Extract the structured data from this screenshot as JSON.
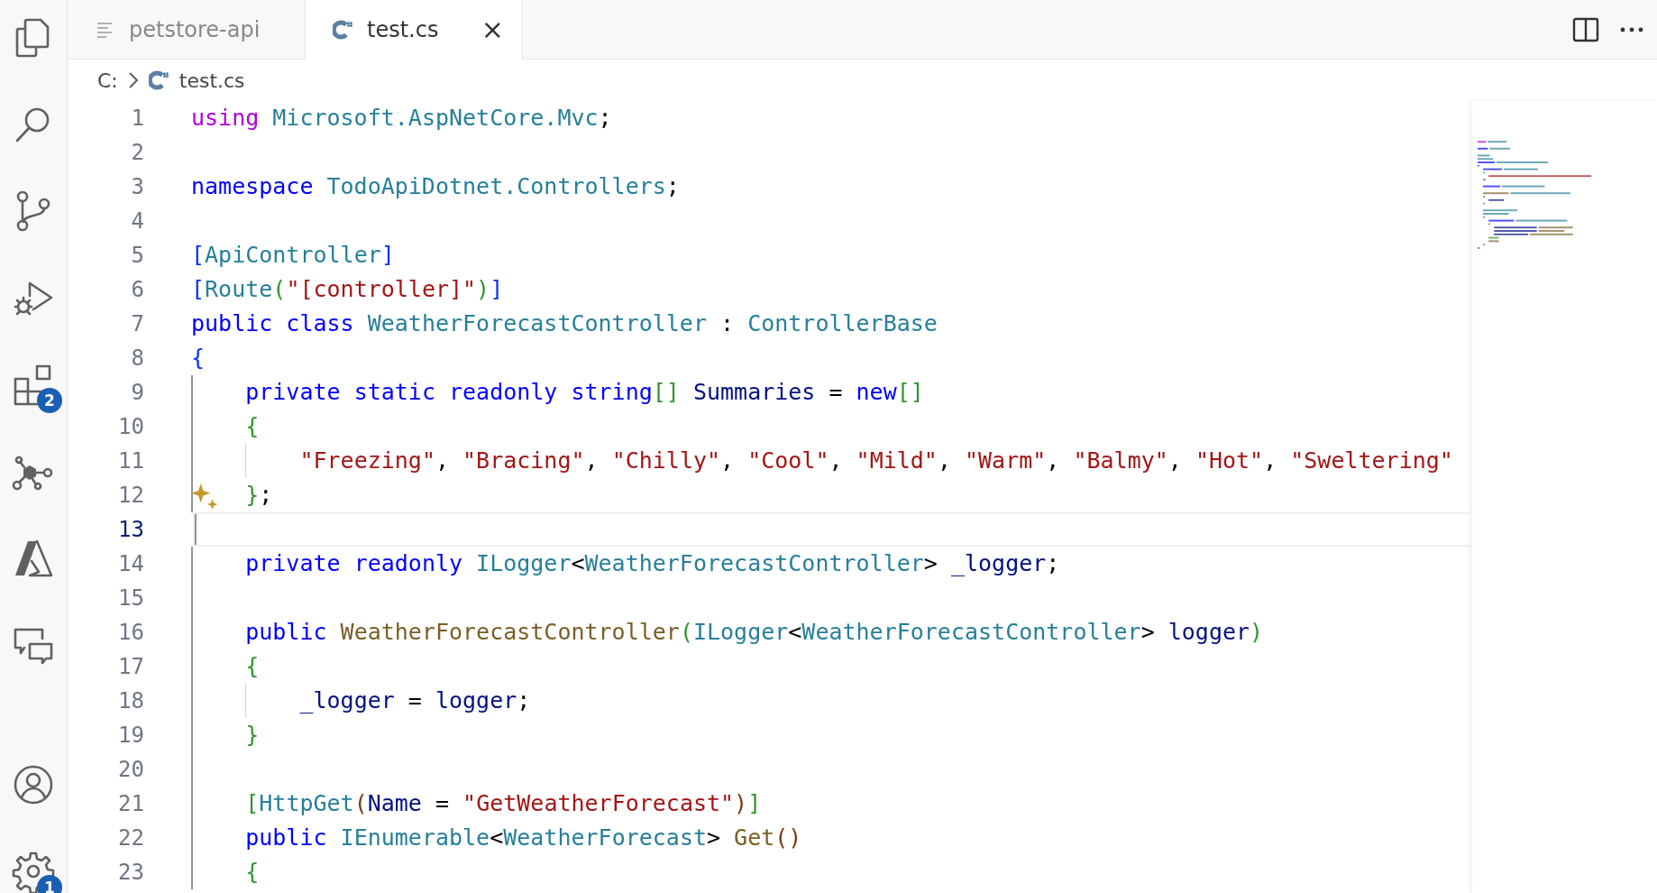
{
  "activity_bar": {
    "extensions_badge": "2",
    "settings_badge": "1"
  },
  "tabs": [
    {
      "label": "petstore-api",
      "kind": "preview",
      "selected": false
    },
    {
      "label": "test.cs",
      "kind": "csharp",
      "selected": true,
      "close": "×"
    }
  ],
  "breadcrumb": {
    "items": [
      {
        "label": "C:",
        "kind": "drive"
      },
      {
        "label": "test.cs",
        "kind": "csharp"
      }
    ]
  },
  "editor": {
    "lines": [
      {
        "number": "1",
        "current": false,
        "sparkle": false,
        "tokens": [
          {
            "kind": "ctl",
            "text": "using "
          },
          {
            "kind": "type",
            "text": "Microsoft.AspNetCore.Mvc"
          },
          {
            "kind": "p",
            "text": ";"
          }
        ]
      },
      {
        "number": "2",
        "current": false,
        "sparkle": false
      },
      {
        "number": "3",
        "current": false,
        "sparkle": false,
        "tokens": [
          {
            "kind": "kw",
            "text": "namespace "
          },
          {
            "kind": "type",
            "text": "TodoApiDotnet.Controllers"
          },
          {
            "kind": "p",
            "text": ";"
          }
        ]
      },
      {
        "number": "4",
        "current": false,
        "sparkle": false
      },
      {
        "number": "5",
        "current": false,
        "sparkle": false,
        "tokens": [
          {
            "kind": "b1",
            "text": "["
          },
          {
            "kind": "type",
            "text": "ApiController"
          },
          {
            "kind": "b1",
            "text": "]"
          }
        ]
      },
      {
        "number": "6",
        "current": false,
        "sparkle": false,
        "tokens": [
          {
            "kind": "b1",
            "text": "["
          },
          {
            "kind": "type",
            "text": "Route"
          },
          {
            "kind": "b2",
            "text": "("
          },
          {
            "kind": "str",
            "text": "\"[controller]\""
          },
          {
            "kind": "b2",
            "text": ")"
          },
          {
            "kind": "b1",
            "text": "]"
          }
        ]
      },
      {
        "number": "7",
        "current": false,
        "sparkle": false,
        "tokens": [
          {
            "kind": "kw",
            "text": "public class "
          },
          {
            "kind": "type",
            "text": "WeatherForecastController"
          },
          {
            "kind": "p",
            "text": " : "
          },
          {
            "kind": "type",
            "text": "ControllerBase"
          }
        ]
      },
      {
        "number": "8",
        "current": false,
        "sparkle": false,
        "tokens": [
          {
            "kind": "b1",
            "text": "{"
          }
        ]
      },
      {
        "number": "9",
        "current": false,
        "sparkle": false,
        "tokens": [
          {
            "kind": "kw",
            "text": "    private static readonly string"
          },
          {
            "kind": "b2",
            "text": "[]"
          },
          {
            "kind": "var",
            "text": " Summaries"
          },
          {
            "kind": "p",
            "text": " = "
          },
          {
            "kind": "kw",
            "text": "new"
          },
          {
            "kind": "b2",
            "text": "[]"
          }
        ]
      },
      {
        "number": "10",
        "current": false,
        "sparkle": false,
        "tokens": [
          {
            "kind": "b2",
            "text": "    {"
          }
        ]
      },
      {
        "number": "11",
        "current": false,
        "sparkle": false,
        "tokens": [
          {
            "kind": "str",
            "text": "        \"Freezing\""
          },
          {
            "kind": "p",
            "text": ", "
          },
          {
            "kind": "str",
            "text": "\"Bracing\""
          },
          {
            "kind": "p",
            "text": ", "
          },
          {
            "kind": "str",
            "text": "\"Chilly\""
          },
          {
            "kind": "p",
            "text": ", "
          },
          {
            "kind": "str",
            "text": "\"Cool\""
          },
          {
            "kind": "p",
            "text": ", "
          },
          {
            "kind": "str",
            "text": "\"Mild\""
          },
          {
            "kind": "p",
            "text": ", "
          },
          {
            "kind": "str",
            "text": "\"Warm\""
          },
          {
            "kind": "p",
            "text": ", "
          },
          {
            "kind": "str",
            "text": "\"Balmy\""
          },
          {
            "kind": "p",
            "text": ", "
          },
          {
            "kind": "str",
            "text": "\"Hot\""
          },
          {
            "kind": "p",
            "text": ", "
          },
          {
            "kind": "str",
            "text": "\"Sweltering\""
          }
        ]
      },
      {
        "number": "12",
        "current": false,
        "sparkle": true,
        "tokens": [
          {
            "kind": "b2",
            "text": "    }"
          },
          {
            "kind": "p",
            "text": ";"
          }
        ]
      },
      {
        "number": "13",
        "current": true,
        "sparkle": false
      },
      {
        "number": "14",
        "current": false,
        "sparkle": false,
        "tokens": [
          {
            "kind": "kw",
            "text": "    private readonly "
          },
          {
            "kind": "type",
            "text": "ILogger"
          },
          {
            "kind": "p",
            "text": "<"
          },
          {
            "kind": "type",
            "text": "WeatherForecastController"
          },
          {
            "kind": "p",
            "text": "> "
          },
          {
            "kind": "var",
            "text": "_logger"
          },
          {
            "kind": "p",
            "text": ";"
          }
        ]
      },
      {
        "number": "15",
        "current": false,
        "sparkle": false
      },
      {
        "number": "16",
        "current": false,
        "sparkle": false,
        "tokens": [
          {
            "kind": "kw",
            "text": "    public "
          },
          {
            "kind": "fn",
            "text": "WeatherForecastController"
          },
          {
            "kind": "b2",
            "text": "("
          },
          {
            "kind": "type",
            "text": "ILogger"
          },
          {
            "kind": "p",
            "text": "<"
          },
          {
            "kind": "type",
            "text": "WeatherForecastController"
          },
          {
            "kind": "p",
            "text": "> "
          },
          {
            "kind": "var",
            "text": "logger"
          },
          {
            "kind": "b2",
            "text": ")"
          }
        ]
      },
      {
        "number": "17",
        "current": false,
        "sparkle": false,
        "tokens": [
          {
            "kind": "b2",
            "text": "    {"
          }
        ]
      },
      {
        "number": "18",
        "current": false,
        "sparkle": false,
        "tokens": [
          {
            "kind": "var",
            "text": "        _logger"
          },
          {
            "kind": "p",
            "text": " = "
          },
          {
            "kind": "var",
            "text": "logger"
          },
          {
            "kind": "p",
            "text": ";"
          }
        ]
      },
      {
        "number": "19",
        "current": false,
        "sparkle": false,
        "tokens": [
          {
            "kind": "b2",
            "text": "    }"
          }
        ]
      },
      {
        "number": "20",
        "current": false,
        "sparkle": false
      },
      {
        "number": "21",
        "current": false,
        "sparkle": false,
        "tokens": [
          {
            "kind": "b2",
            "text": "    ["
          },
          {
            "kind": "type",
            "text": "HttpGet"
          },
          {
            "kind": "b3",
            "text": "("
          },
          {
            "kind": "var",
            "text": "Name"
          },
          {
            "kind": "p",
            "text": " = "
          },
          {
            "kind": "str",
            "text": "\"GetWeatherForecast\""
          },
          {
            "kind": "b3",
            "text": ")"
          },
          {
            "kind": "b2",
            "text": "]"
          }
        ]
      },
      {
        "number": "22",
        "current": false,
        "sparkle": false,
        "tokens": [
          {
            "kind": "kw",
            "text": "    public "
          },
          {
            "kind": "type",
            "text": "IEnumerable"
          },
          {
            "kind": "p",
            "text": "<"
          },
          {
            "kind": "type",
            "text": "WeatherForecast"
          },
          {
            "kind": "p",
            "text": "> "
          },
          {
            "kind": "fn",
            "text": "Get"
          },
          {
            "kind": "b3",
            "text": "()"
          }
        ]
      },
      {
        "number": "23",
        "current": false,
        "sparkle": false,
        "tokens": [
          {
            "kind": "b2",
            "text": "    {"
          }
        ]
      }
    ]
  }
}
